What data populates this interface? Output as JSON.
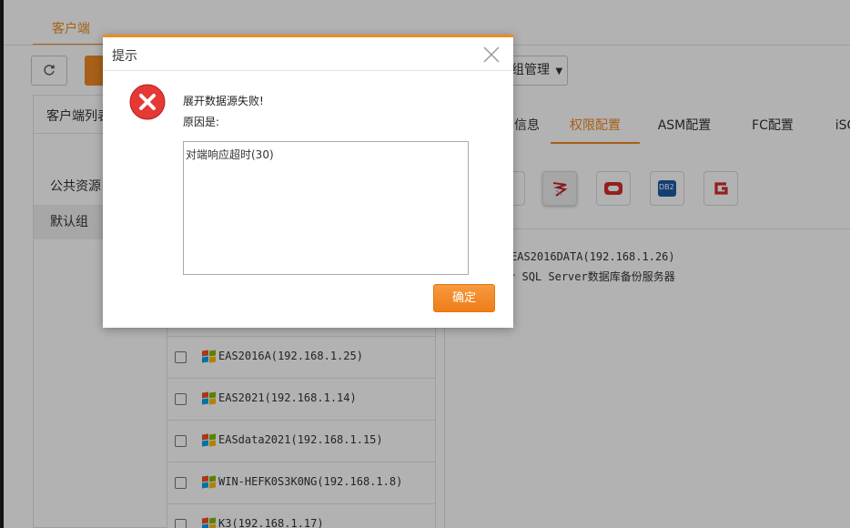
{
  "app": {
    "top_tab": "客户端",
    "group_button_label": "组管理",
    "left_panel_title": "客户端列表",
    "left_items": [
      "公共资源",
      "默认组"
    ],
    "hosts": [
      "EAS2016A(192.168.1.25)",
      "EAS2021(192.168.1.14)",
      "EASdata2021(192.168.1.15)",
      "WIN-HEFK0S3K0NG(192.168.1.8)",
      "K3(192.168.1.17)"
    ],
    "right_tabs": [
      "信息",
      "权限配置",
      "ASM配置",
      "FC配置",
      "iSC"
    ],
    "active_right_tab": "权限配置",
    "db_icons": [
      "sql-server-icon",
      "oracle-icon",
      "db2-icon",
      "gbase-icon"
    ],
    "db2_label": "DB2",
    "tree": {
      "host": "EAS2016DATA(192.168.1.26)",
      "service": "SQL Server数据库备份服务器"
    }
  },
  "dialog": {
    "title": "提示",
    "message": "展开数据源失败!",
    "reason_label": "原因是:",
    "reason_text": "对端响应超时(30)",
    "ok_label": "确定"
  },
  "colors": {
    "accent": "#f08a24",
    "error": "#e53935",
    "overlay": "rgba(0,0,0,0.30)"
  }
}
